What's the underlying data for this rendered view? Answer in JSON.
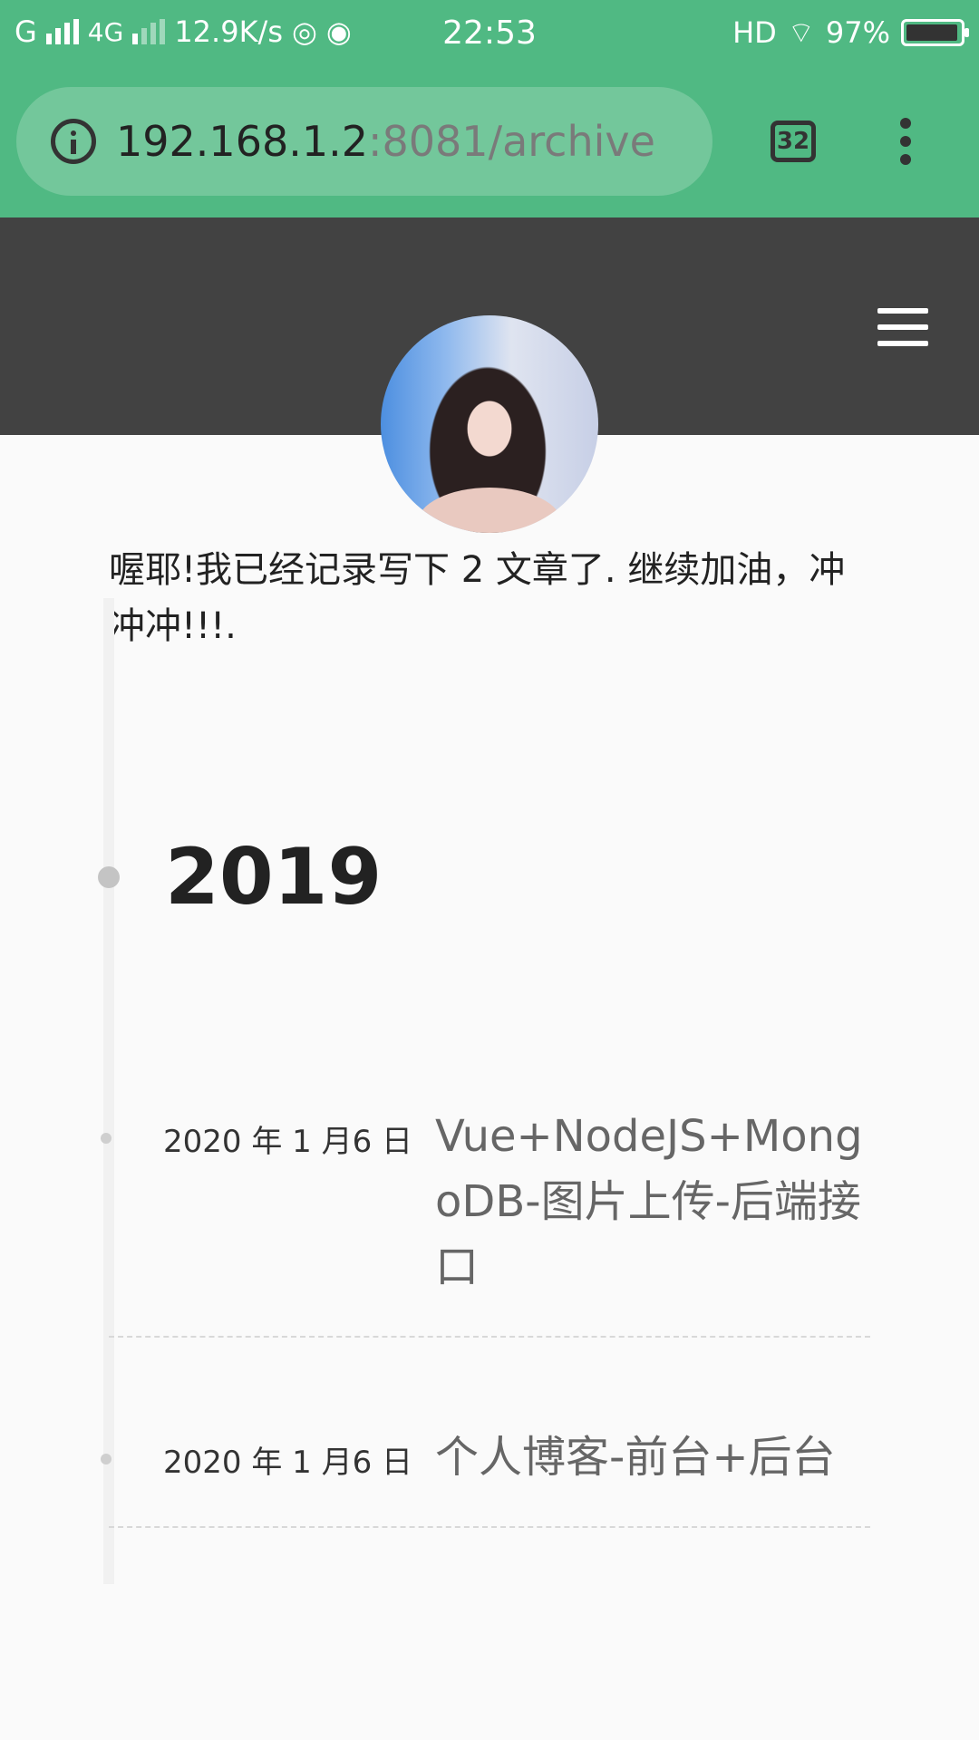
{
  "status_bar": {
    "carrier1": "G",
    "carrier2": "4G",
    "net_speed": "12.9K/s",
    "time": "22:53",
    "hd": "HD",
    "battery": "97%",
    "battery_level": 0.97
  },
  "browser": {
    "url_host": "192.168.1.2",
    "url_path": ":8081/archive",
    "tab_count": "32"
  },
  "intro": "喔耶!我已经记录写下 2 文章了. 继续加油，冲冲冲!!!.",
  "archive": {
    "year": "2019",
    "posts": [
      {
        "date": "2020 年 1 月6 日",
        "title": "Vue+NodeJS+MongoDB-图片上传-后端接口"
      },
      {
        "date": "2020 年 1 月6 日",
        "title": "个人博客-前台+后台"
      }
    ]
  },
  "colors": {
    "browser_bar": "#50b983",
    "header": "#424242",
    "page_bg": "#fafafa"
  }
}
